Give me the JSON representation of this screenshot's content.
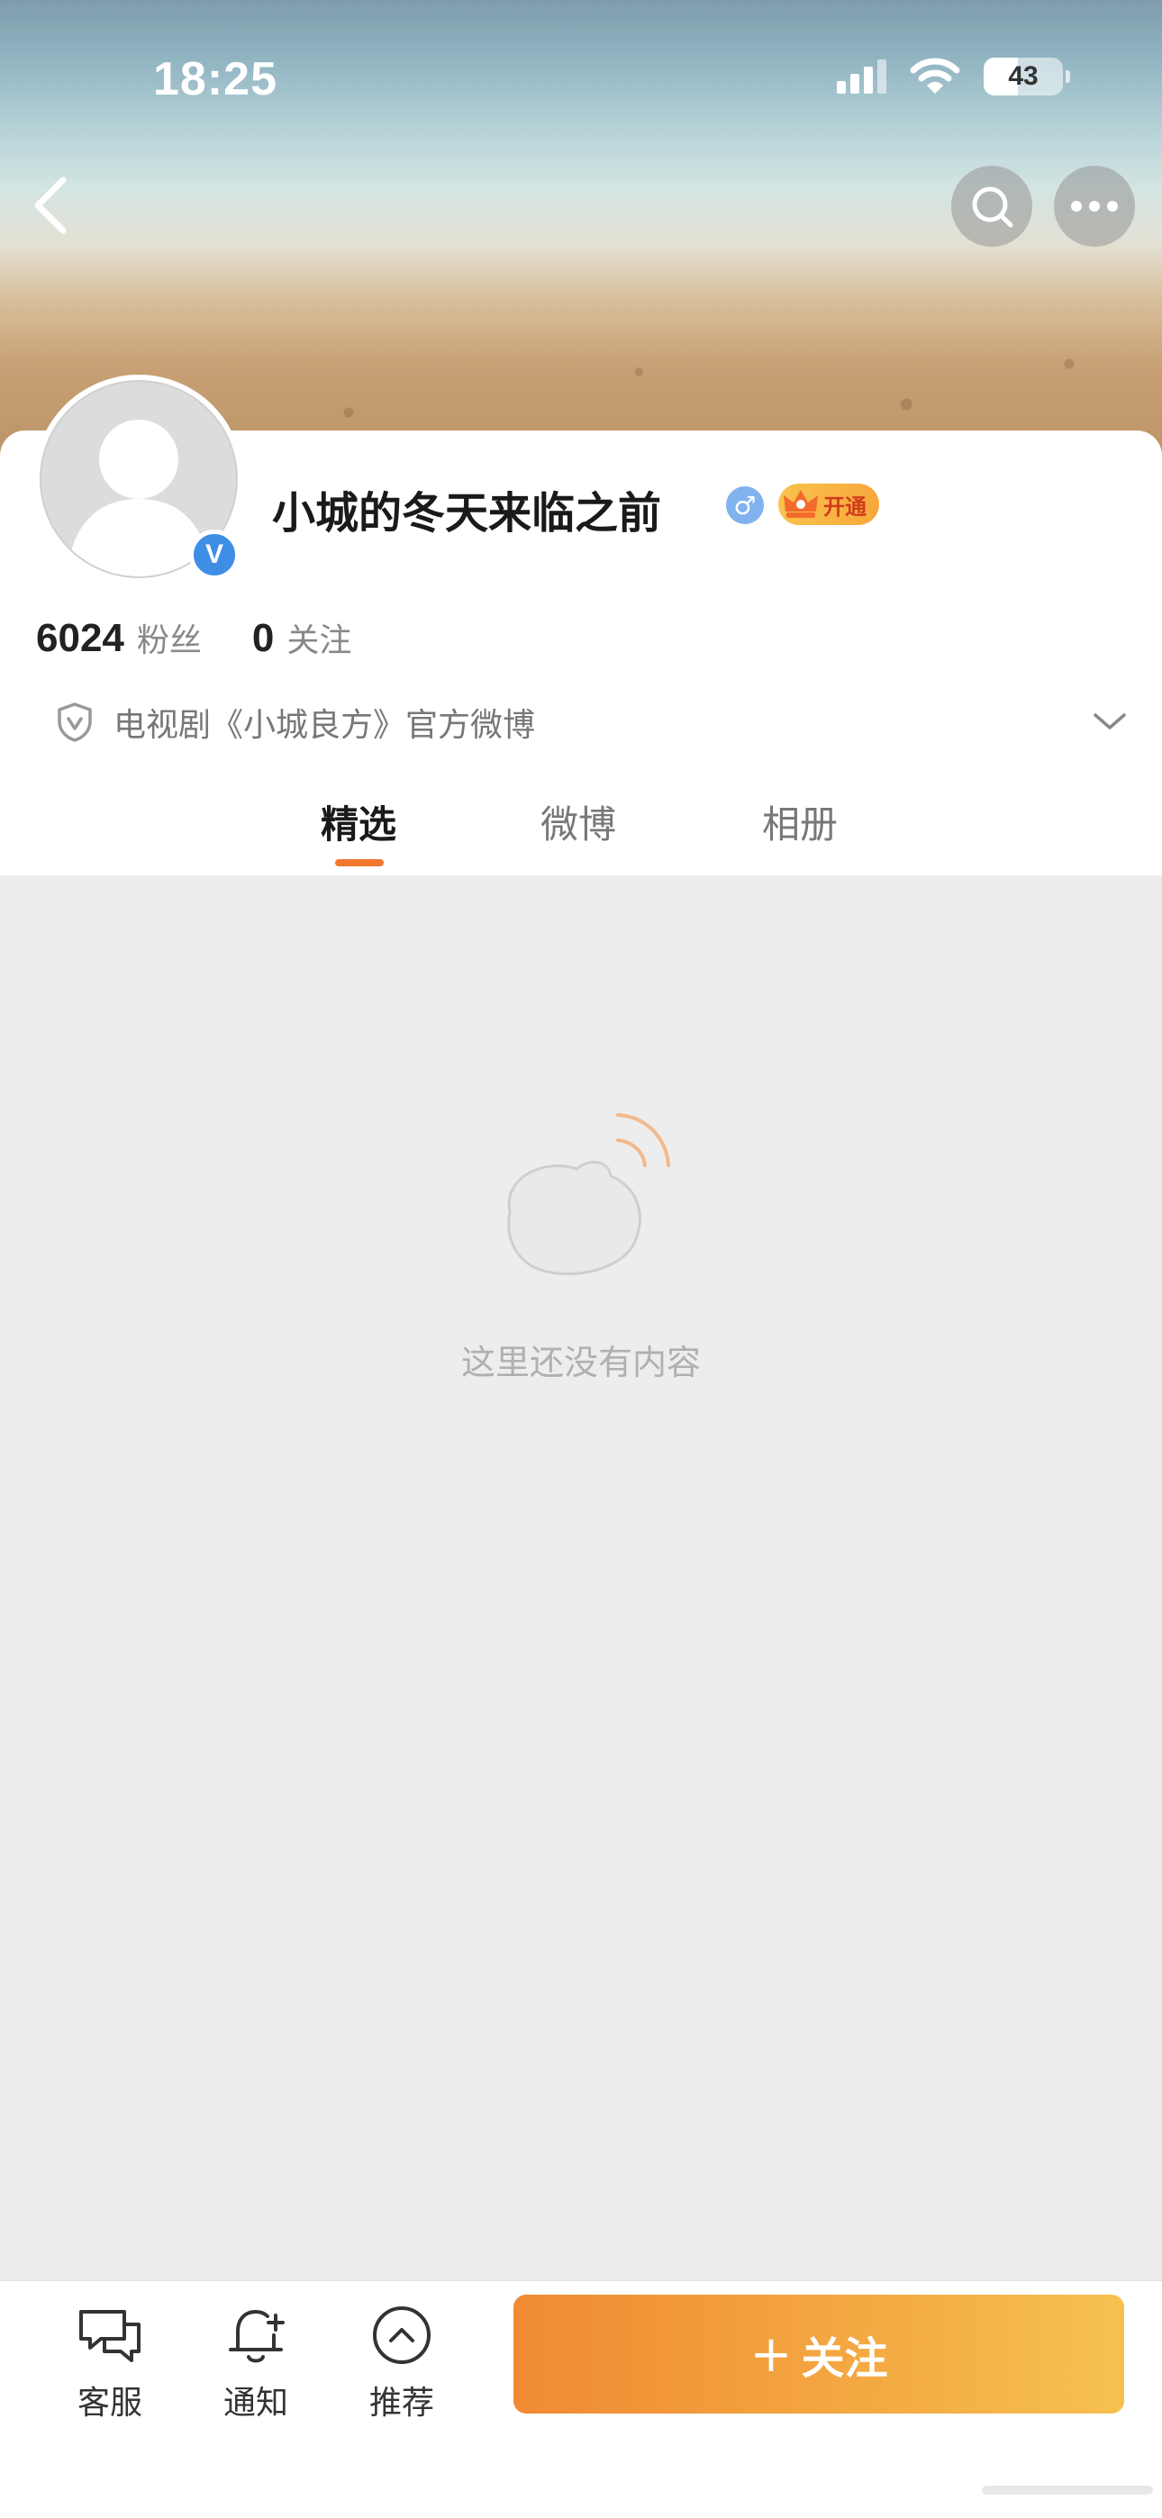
{
  "status_bar": {
    "time": "18:25",
    "battery_level": "43"
  },
  "header": {
    "back_label": "",
    "search_label": "",
    "more_label": ""
  },
  "profile": {
    "name": "小城的冬天来临之前",
    "gender_symbol": "♂",
    "vip_label": "开通",
    "verified_badge": "V",
    "followers_count": "6024",
    "followers_label": "粉丝",
    "following_count": "0",
    "following_label": "关注",
    "verification_text": "电视剧《小城良方》官方微博"
  },
  "tabs": [
    {
      "label": "精选",
      "active": true
    },
    {
      "label": "微博",
      "active": false
    },
    {
      "label": "相册",
      "active": false
    }
  ],
  "empty_state": {
    "text": "这里还没有内容"
  },
  "bottom_bar": {
    "items": [
      {
        "label": "客服",
        "icon": "chat-icon"
      },
      {
        "label": "通知",
        "icon": "bell-plus-icon"
      },
      {
        "label": "推荐",
        "icon": "chevron-up-circle-icon"
      }
    ],
    "follow_button": {
      "plus": "+",
      "label": "关注"
    }
  },
  "colors": {
    "accent": "#f0782c",
    "verified_blue": "#3e8ee6",
    "follow_gradient_start": "#f08a34",
    "follow_gradient_end": "#f6c14f"
  }
}
